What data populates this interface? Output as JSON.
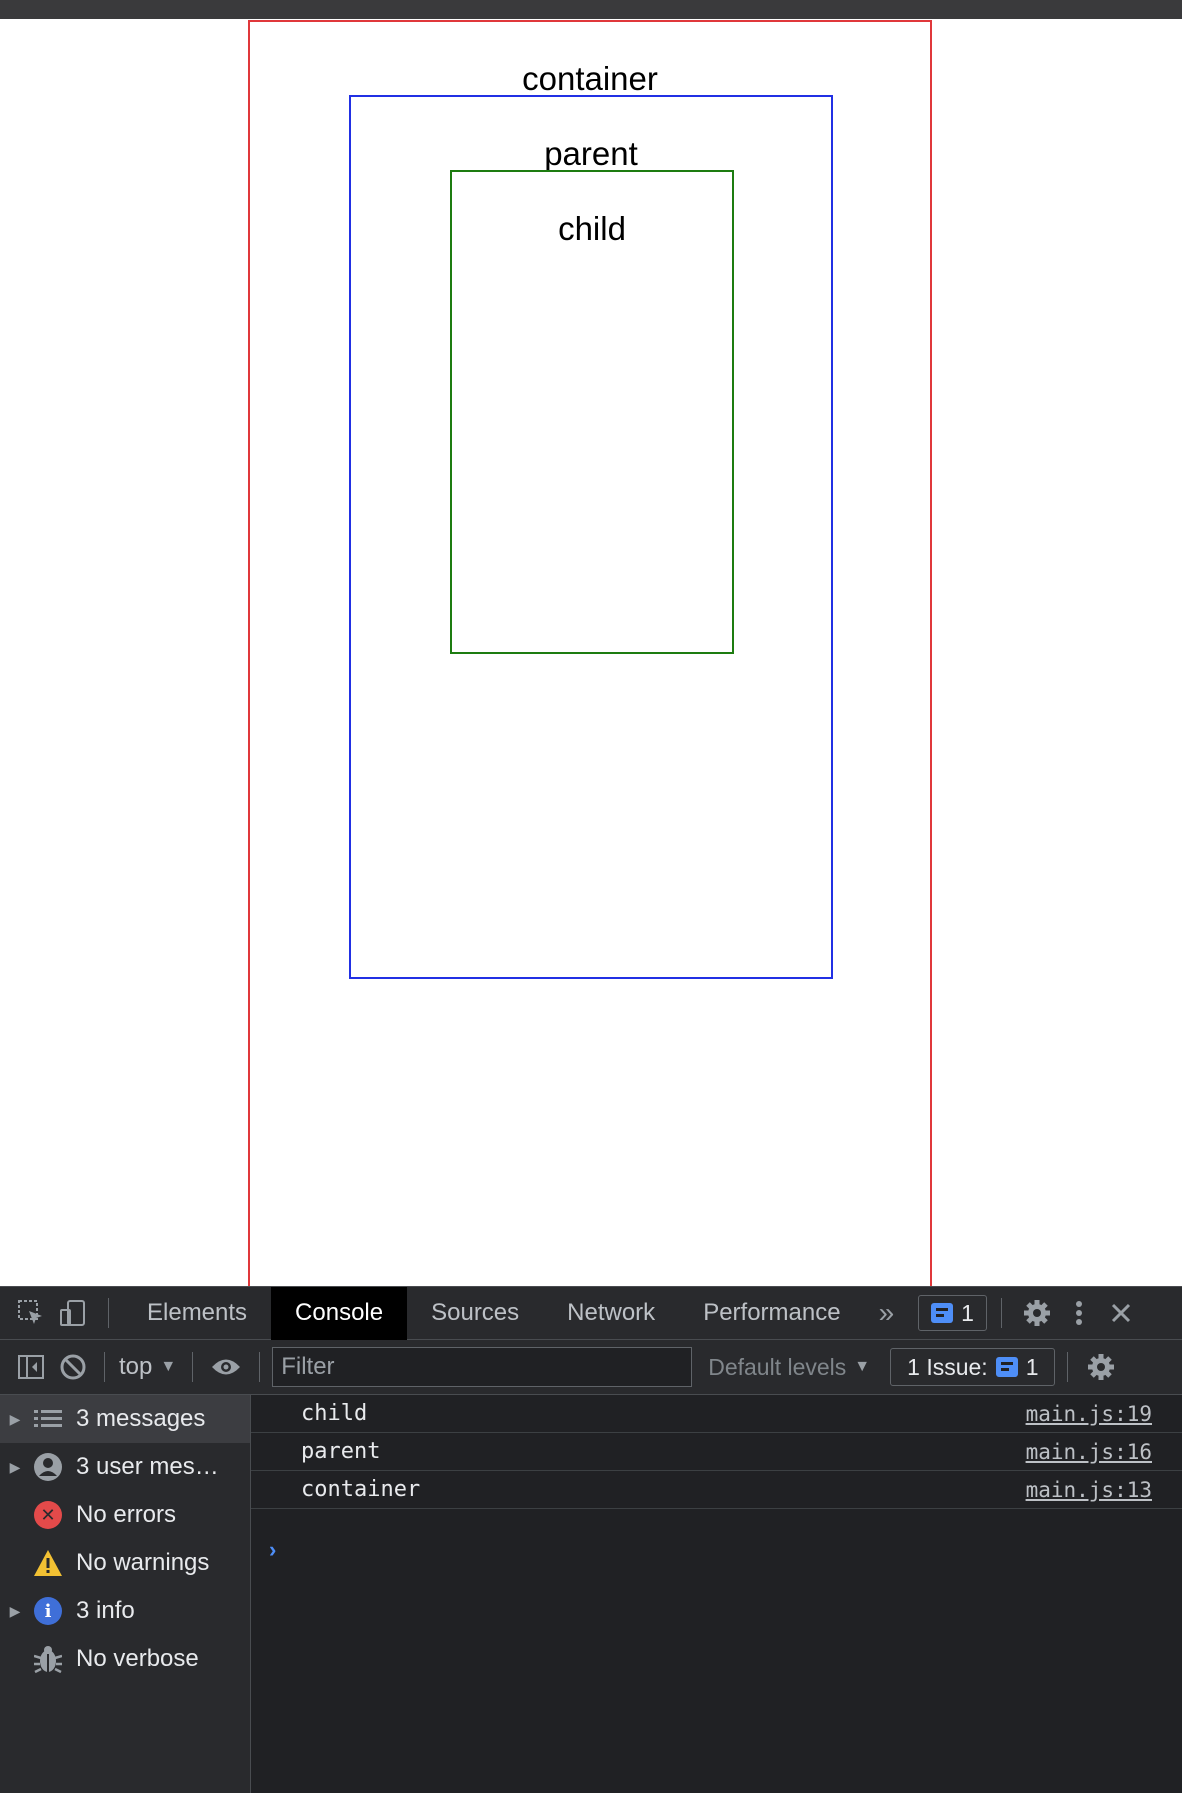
{
  "page": {
    "boxes": {
      "container": {
        "label": "container",
        "border_color": "#e0383b"
      },
      "parent": {
        "label": "parent",
        "border_color": "#2130e4"
      },
      "child": {
        "label": "child",
        "border_color": "#1d7c10"
      }
    }
  },
  "devtools": {
    "toolbar_icons": [
      "inspect-element-icon",
      "device-toolbar-icon"
    ],
    "tabs": [
      {
        "label": "Elements",
        "active": false
      },
      {
        "label": "Console",
        "active": true
      },
      {
        "label": "Sources",
        "active": false
      },
      {
        "label": "Network",
        "active": false
      },
      {
        "label": "Performance",
        "active": false
      }
    ],
    "more_tabs_glyph": "»",
    "issues_badge_count": "1",
    "filterbar": {
      "context": "top",
      "filter_placeholder": "Filter",
      "levels_label": "Default levels",
      "issues_label": "1 Issue:",
      "issues_count": "1"
    },
    "sidebar": [
      {
        "label": "3 messages",
        "icon": "list-icon",
        "expandable": true,
        "selected": true
      },
      {
        "label": "3 user mes…",
        "icon": "user-icon",
        "expandable": true,
        "selected": false
      },
      {
        "label": "No errors",
        "icon": "error-icon",
        "expandable": false,
        "selected": false
      },
      {
        "label": "No warnings",
        "icon": "warning-icon",
        "expandable": false,
        "selected": false
      },
      {
        "label": "3 info",
        "icon": "info-icon",
        "expandable": true,
        "selected": false
      },
      {
        "label": "No verbose",
        "icon": "bug-icon",
        "expandable": false,
        "selected": false
      }
    ],
    "console_messages": [
      {
        "text": "child",
        "source": "main.js:19"
      },
      {
        "text": "parent",
        "source": "main.js:16"
      },
      {
        "text": "container",
        "source": "main.js:13"
      }
    ],
    "prompt_glyph": "›",
    "colors": {
      "accent_blue": "#4e8ef7",
      "error_red": "#e34a4a",
      "warning_yellow": "#f2c133",
      "info_blue": "#3f6fd8"
    }
  }
}
